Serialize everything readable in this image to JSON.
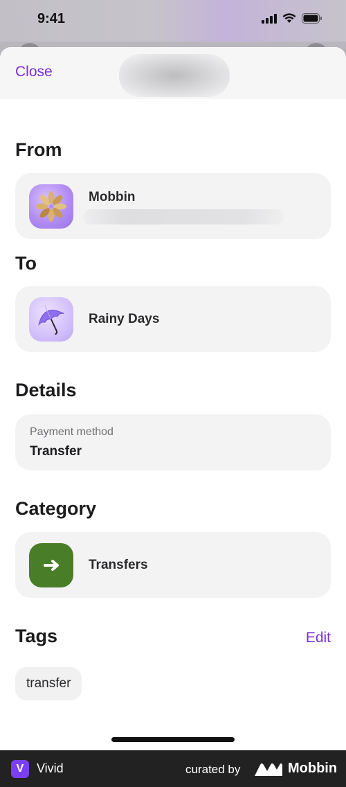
{
  "status_bar": {
    "time": "9:41"
  },
  "sheet": {
    "close_label": "Close"
  },
  "from": {
    "title": "From",
    "name": "Mobbin",
    "icon": "flower-icon"
  },
  "to": {
    "title": "To",
    "name": "Rainy Days",
    "icon": "umbrella-icon"
  },
  "details": {
    "title": "Details",
    "payment_label": "Payment method",
    "payment_value": "Transfer"
  },
  "category": {
    "title": "Category",
    "name": "Transfers",
    "icon": "arrow-right-icon",
    "color": "#4a7d28"
  },
  "tags": {
    "title": "Tags",
    "edit_label": "Edit",
    "items": [
      "transfer"
    ]
  },
  "footer": {
    "app_name": "Vivid",
    "app_logo_letter": "V",
    "curated_by": "curated by",
    "brand": "Mobbin"
  },
  "colors": {
    "accent": "#7b2fd6",
    "card_bg": "#f3f3f4",
    "footer_bg": "#222222"
  }
}
